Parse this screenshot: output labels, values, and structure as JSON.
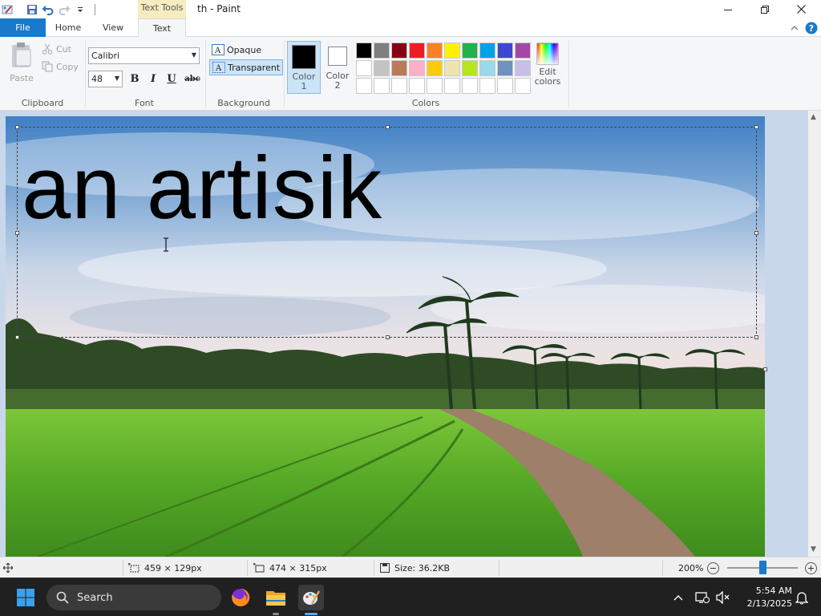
{
  "titlebar": {
    "context_tab": "Text Tools",
    "title": "th - Paint"
  },
  "tabs": {
    "file": "File",
    "home": "Home",
    "view": "View",
    "text": "Text"
  },
  "clipboard": {
    "paste": "Paste",
    "cut": "Cut",
    "copy": "Copy",
    "label": "Clipboard"
  },
  "font": {
    "family": "Calibri",
    "size": "48",
    "bold": "B",
    "italic": "I",
    "underline": "U",
    "strike": "abc",
    "label": "Font"
  },
  "background": {
    "opaque": "Opaque",
    "transparent": "Transparent",
    "label": "Background"
  },
  "colors": {
    "color1_line1": "Color",
    "color1_line2": "1",
    "color2_line1": "Color",
    "color2_line2": "2",
    "color1_value": "#000000",
    "color2_value": "#ffffff",
    "edit_line1": "Edit",
    "edit_line2": "colors",
    "label": "Colors",
    "palette": [
      "#000000",
      "#7f7f7f",
      "#880015",
      "#ed1c24",
      "#ff7f27",
      "#fff200",
      "#22b14c",
      "#00a2e8",
      "#3f48cc",
      "#a349a4",
      "#ffffff",
      "#c3c3c3",
      "#b97a57",
      "#ffaec9",
      "#ffc90e",
      "#efe4b0",
      "#b5e61d",
      "#99d9ea",
      "#7092be",
      "#c8bfe7",
      "#ffffff",
      "#ffffff",
      "#ffffff",
      "#ffffff",
      "#ffffff",
      "#ffffff",
      "#ffffff",
      "#ffffff",
      "#ffffff",
      "#ffffff"
    ]
  },
  "canvas": {
    "text": "an artisik"
  },
  "status": {
    "selection_size": "459 × 129px",
    "image_size": "474 × 315px",
    "file_size": "Size: 36.2KB",
    "zoom": "200%",
    "zoom_fraction": 0.5
  },
  "taskbar": {
    "search_label": "Search",
    "time": "5:54 AM",
    "date": "2/13/2025"
  }
}
